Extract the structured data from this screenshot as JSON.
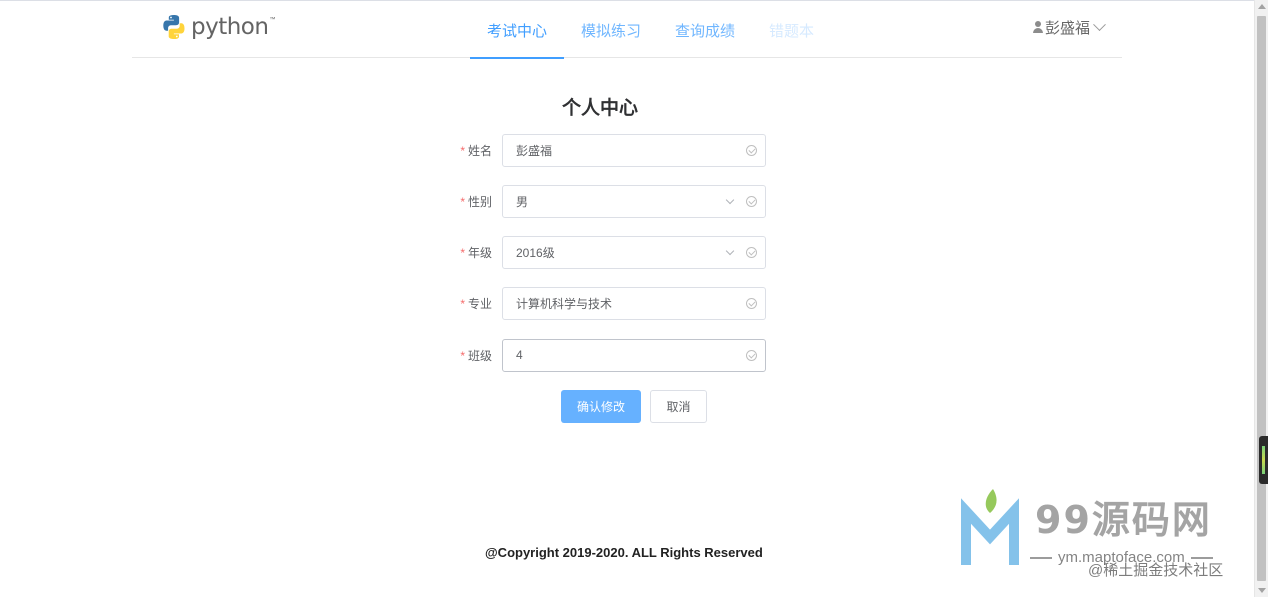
{
  "header": {
    "logo_text": "python",
    "logo_tm": "™",
    "nav": [
      {
        "label": "考试中心"
      },
      {
        "label": "模拟练习"
      },
      {
        "label": "查询成绩"
      },
      {
        "label": "错题本"
      }
    ],
    "active_tab": "考试中心",
    "user_name": "彭盛福"
  },
  "main": {
    "title": "个人中心",
    "fields": {
      "name": {
        "label": "姓名",
        "value": "彭盛福"
      },
      "gender": {
        "label": "性别",
        "value": "男"
      },
      "grade": {
        "label": "年级",
        "value": "2016级"
      },
      "major": {
        "label": "专业",
        "value": "计算机科学与技术"
      },
      "class": {
        "label": "班级",
        "value": "4"
      }
    },
    "required_mark": "*",
    "confirm_label": "确认修改",
    "cancel_label": "取消"
  },
  "footer": {
    "copyright": "@Copyright 2019-2020. ALL Rights Reserved"
  },
  "watermark": {
    "brand": "99源码网",
    "url": "ym.maptoface.com",
    "credit": "@稀土掘金技术社区"
  },
  "colors": {
    "accent": "#409eff",
    "primary_button": "#66b1ff",
    "required": "#f56c6c",
    "logo_blue": "#3776ab",
    "logo_yellow": "#ffd43b"
  }
}
